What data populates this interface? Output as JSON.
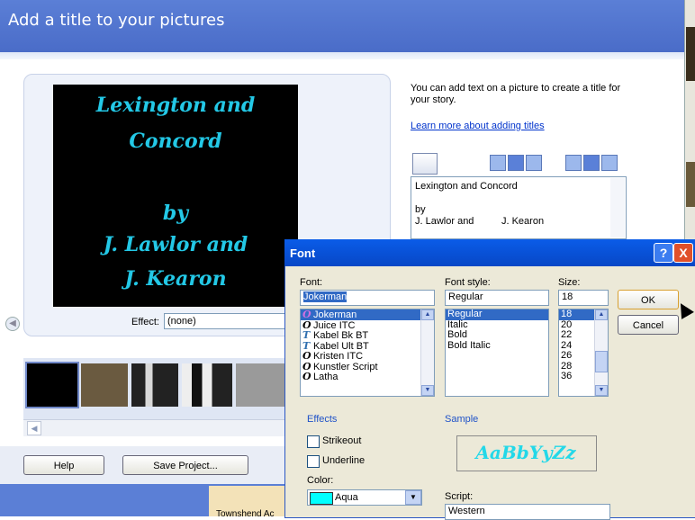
{
  "header": {
    "title": "Add a title to your pictures"
  },
  "preview": {
    "title_lines": [
      "Lexington and",
      "Concord",
      "by",
      "J. Lawlor and",
      "J. Kearon"
    ],
    "effect_label": "Effect:",
    "effect_value": "(none)"
  },
  "intro": {
    "text": "You can add text on a picture to create a title for your story.",
    "learn_link": "Learn more about adding titles"
  },
  "title_text": {
    "line1": "Lexington and Concord",
    "line2": "by",
    "line3": "J. Lawlor and          J. Kearon"
  },
  "bottom": {
    "help_label": "Help",
    "save_label": "Save Project...",
    "townshend_label": "Townshend Ac"
  },
  "font_dialog": {
    "title": "Font",
    "help_glyph": "?",
    "close_glyph": "X",
    "font_label": "Font:",
    "font_value": "Jokerman",
    "fonts": [
      "Jokerman",
      "Juice ITC",
      "Kabel Bk BT",
      "Kabel Ult BT",
      "Kristen ITC",
      "Kunstler Script",
      "Latha"
    ],
    "font_glyphs": [
      "O",
      "O",
      "T",
      "T",
      "O",
      "O",
      "O"
    ],
    "style_label": "Font style:",
    "style_value": "Regular",
    "styles": [
      "Regular",
      "Italic",
      "Bold",
      "Bold Italic"
    ],
    "size_label": "Size:",
    "size_value": "18",
    "sizes": [
      "18",
      "20",
      "22",
      "24",
      "26",
      "28",
      "36"
    ],
    "ok_label": "OK",
    "cancel_label": "Cancel",
    "effects_label": "Effects",
    "strikeout_label": "Strikeout",
    "underline_label": "Underline",
    "color_label": "Color:",
    "color_value": "Aqua",
    "sample_label": "Sample",
    "sample_text": "AaBbYyZz",
    "script_label": "Script:",
    "script_value": "Western"
  },
  "colors": {
    "header_blue": "#5b7fd6",
    "title_aqua": "#23c8e6",
    "selection": "#316ac5",
    "dialog_bg": "#ece9d8"
  }
}
